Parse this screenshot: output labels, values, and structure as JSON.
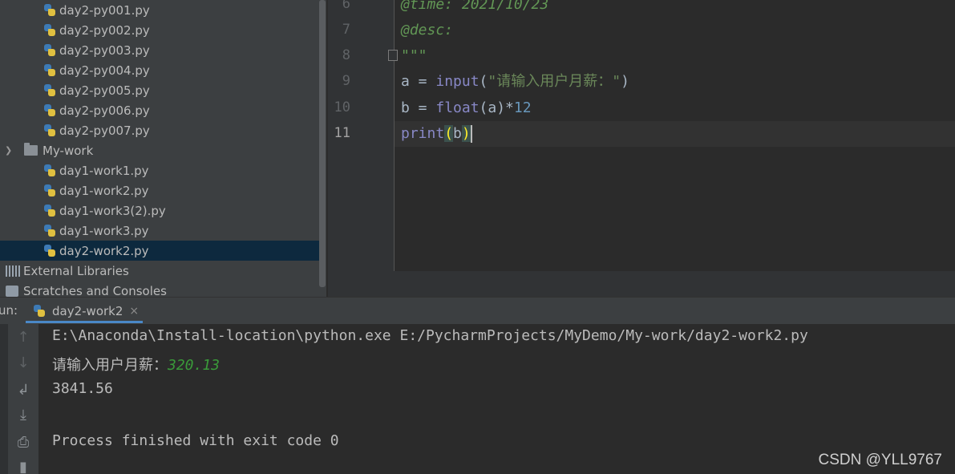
{
  "project_tree": {
    "files_top": [
      "day2-py001.py",
      "day2-py002.py",
      "day2-py003.py",
      "day2-py004.py",
      "day2-py005.py",
      "day2-py006.py",
      "day2-py007.py"
    ],
    "folder": "My-work",
    "folder_files": [
      "day1-work1.py",
      "day1-work2.py",
      "day1-work3(2).py",
      "day1-work3.py",
      "day2-work2.py"
    ],
    "selected_file": "day2-work2.py",
    "external_libraries": "External Libraries",
    "scratches": "Scratches and Consoles"
  },
  "editor": {
    "line_numbers": [
      "6",
      "7",
      "8",
      "9",
      "10",
      "11"
    ],
    "current_line": "11",
    "lines": {
      "l6": "@time: 2021/10/23",
      "l7": "@desc:",
      "l8": "\"\"\"",
      "l9_var": "a",
      "l9_eq": " = ",
      "l9_fn": "input",
      "l9_open": "(",
      "l9_str": "\"请输入用户月薪：\"",
      "l9_close": ")",
      "l10_var": "b",
      "l10_eq": " = ",
      "l10_fn": "float",
      "l10_args": "(a)*",
      "l10_num": "12",
      "l11_fn": "print",
      "l11_open": "(",
      "l11_arg": "b",
      "l11_close": ")"
    }
  },
  "run": {
    "label": "un:",
    "tab_name": "day2-work2",
    "close_symbol": "×",
    "toolbar_icons": [
      "up-arrow-icon",
      "down-arrow-icon",
      "soft-wrap-icon",
      "scroll-to-end-icon",
      "print-icon",
      "trash-icon"
    ],
    "console": {
      "command": "E:\\Anaconda\\Install-location\\python.exe E:/PycharmProjects/MyDemo/My-work/day2-work2.py",
      "prompt": "请输入用户月薪：",
      "user_input": "320.13",
      "result": "3841.56",
      "exit_message": "Process finished with exit code 0"
    }
  },
  "watermark": "CSDN @YLL9767"
}
